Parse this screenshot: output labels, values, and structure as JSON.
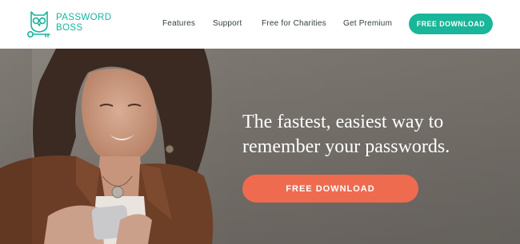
{
  "brand": {
    "name_line1": "PASSWORD",
    "name_line2": "BOSS",
    "color": "#16b59c"
  },
  "nav": {
    "items": [
      {
        "label": "Features"
      },
      {
        "label": "Support"
      },
      {
        "label": "Free for Charities"
      },
      {
        "label": "Get Premium"
      }
    ],
    "cta_label": "FREE DOWNLOAD",
    "cta_color": "#1ab69a"
  },
  "hero": {
    "heading_line1": "The fastest, easiest way to",
    "heading_line2": "remember your passwords.",
    "cta_label": "FREE DOWNLOAD",
    "cta_color": "#ef6b50",
    "image_subject": "woman-smiling-at-phone-photo"
  },
  "icons": [
    "owl-key-logo-icon"
  ]
}
